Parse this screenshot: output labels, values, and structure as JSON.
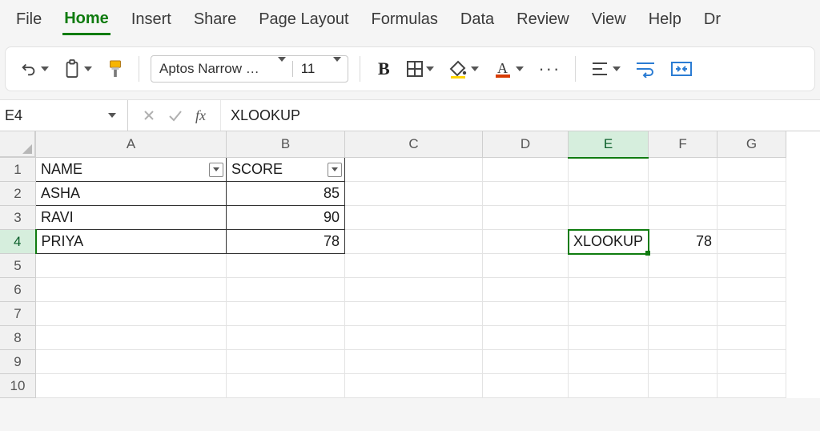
{
  "menu": {
    "tabs": [
      "File",
      "Home",
      "Insert",
      "Share",
      "Page Layout",
      "Formulas",
      "Data",
      "Review",
      "View",
      "Help",
      "Dr"
    ],
    "active_index": 1
  },
  "toolbar": {
    "font_name": "Aptos Narrow …",
    "font_size": "11",
    "bold_glyph": "B",
    "ellipsis": "···"
  },
  "namebox": {
    "ref": "E4"
  },
  "formula_bar": {
    "fx_label": "fx",
    "text": "XLOOKUP"
  },
  "grid": {
    "columns": [
      "A",
      "B",
      "C",
      "D",
      "E",
      "F",
      "G"
    ],
    "selected_col": "E",
    "selected_row": 4,
    "rows_visible": 10,
    "headers": {
      "A": "NAME",
      "B": "SCORE"
    },
    "data_rows": [
      {
        "A": "ASHA",
        "B": "85"
      },
      {
        "A": "RAVI",
        "B": "90"
      },
      {
        "A": "PRIYA",
        "B": "78"
      }
    ],
    "other_cells": {
      "E4": "XLOOKUP",
      "F4": "78"
    }
  },
  "colors": {
    "accent_green": "#107c10",
    "fill_accent": "#ffd500",
    "font_accent": "#d83b01"
  }
}
